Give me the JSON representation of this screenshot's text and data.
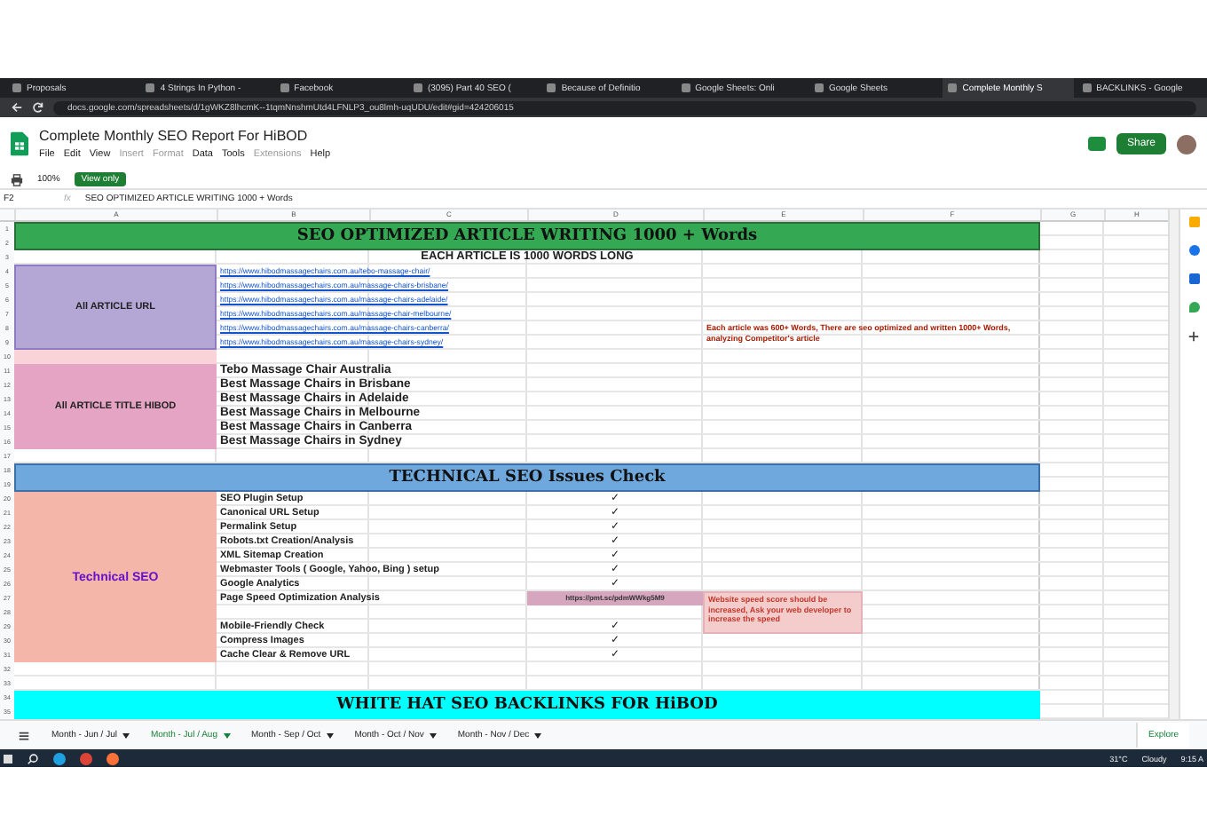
{
  "browser": {
    "tabs": [
      {
        "label": "Proposals",
        "selected": false
      },
      {
        "label": "4 Strings In Python -",
        "selected": false
      },
      {
        "label": "Facebook",
        "selected": false
      },
      {
        "label": "(3095) Part 40 SEO (",
        "selected": false
      },
      {
        "label": "Because of Definitio",
        "selected": false
      },
      {
        "label": "Google Sheets: Onli",
        "selected": false
      },
      {
        "label": "Google Sheets",
        "selected": false
      },
      {
        "label": "Complete Monthly S",
        "selected": true
      },
      {
        "label": "BACKLINKS - Google",
        "selected": false
      }
    ],
    "address": "docs.google.com/spreadsheets/d/1gWKZ8lhcmK--1tqmNnshmUtd4LFNLP3_ou8lmh-uqUDU/edit#gid=424206015"
  },
  "doc": {
    "title": "Complete Monthly SEO Report For HiBOD",
    "menu": [
      {
        "label": "File",
        "disabled": false
      },
      {
        "label": "Edit",
        "disabled": false
      },
      {
        "label": "View",
        "disabled": false
      },
      {
        "label": "Insert",
        "disabled": true
      },
      {
        "label": "Format",
        "disabled": true
      },
      {
        "label": "Data",
        "disabled": false
      },
      {
        "label": "Tools",
        "disabled": false
      },
      {
        "label": "Extensions",
        "disabled": true
      },
      {
        "label": "Help",
        "disabled": false
      }
    ],
    "zoom": "100%",
    "view_mode": "View only",
    "share": "Share"
  },
  "formula_bar": {
    "cell": "F2",
    "fx": "fx",
    "value": "SEO OPTIMIZED ARTICLE WRITING 1000 + Words"
  },
  "columns": [
    "A",
    "B",
    "C",
    "D",
    "E",
    "F",
    "G",
    "H"
  ],
  "row_numbers": [
    "1",
    "2",
    "3",
    "4",
    "5",
    "6",
    "7",
    "8",
    "9",
    "10",
    "11",
    "12",
    "13",
    "14",
    "15",
    "16",
    "17",
    "18",
    "19",
    "20",
    "21",
    "22",
    "23",
    "24",
    "25",
    "26",
    "27",
    "28",
    "29",
    "30",
    "31",
    "32",
    "33",
    "34",
    "35"
  ],
  "sheet": {
    "title": "SEO OPTIMIZED ARTICLE WRITING 1000 + Words",
    "subtitle": "EACH ARTICLE IS 1000 WORDS LONG",
    "url_label": "All ARTICLE URL",
    "urls": [
      "https://www.hibodmassagechairs.com.au/tebo-massage-chair/",
      "https://www.hibodmassagechairs.com.au/massage-chairs-brisbane/",
      "https://www.hibodmassagechairs.com.au/massage-chairs-adelaide/",
      "https://www.hibodmassagechairs.com.au/massage-chair-melbourne/",
      "https://www.hibodmassagechairs.com.au/massage-chairs-canberra/",
      "https://www.hibodmassagechairs.com.au/massage-chairs-sydney/"
    ],
    "article_note": "Each article was 600+ Words, There are seo optimized and written 1000+ Words, analyzing Competitor's article",
    "title_label": "All ARTICLE TITLE HIBOD",
    "titles": [
      "Tebo Massage Chair Australia",
      "Best Massage Chairs in Brisbane",
      "Best Massage Chairs in Adelaide",
      "Best Massage Chairs in Melbourne",
      "Best Massage Chairs in Canberra",
      "Best Massage Chairs in Sydney"
    ],
    "technical_title": "TECHNICAL SEO Issues Check",
    "technical_label": "Technical SEO",
    "technical_items": [
      {
        "kind": "check",
        "label": "SEO Plugin Setup",
        "checked": true,
        "mark": "✓"
      },
      {
        "kind": "check",
        "label": "Canonical URL Setup",
        "checked": true,
        "mark": "✓"
      },
      {
        "kind": "check",
        "label": "Permalink Setup",
        "checked": true,
        "mark": "✓"
      },
      {
        "kind": "check",
        "label": "Robots.txt Creation/Analysis",
        "checked": true,
        "mark": "✓"
      },
      {
        "kind": "check",
        "label": "XML Sitemap Creation",
        "checked": true,
        "mark": "✓"
      },
      {
        "kind": "check",
        "label": "Webmaster Tools ( Google, Yahoo, Bing ) setup",
        "checked": true,
        "mark": "✓"
      },
      {
        "kind": "check",
        "label": "Google Analytics",
        "checked": true,
        "mark": "✓"
      },
      {
        "kind": "link",
        "label": "Page Speed Optimization Analysis",
        "link": "https://pmt.sc/pdmWWkg5M9",
        "note": "Website speed score should be increased, Ask your web developer to increase the speed"
      },
      {
        "kind": "check",
        "label": "Mobile-Friendly Check",
        "checked": true,
        "mark": "✓"
      },
      {
        "kind": "check",
        "label": "Compress Images",
        "checked": true,
        "mark": "✓"
      },
      {
        "kind": "check",
        "label": "Cache Clear & Remove URL",
        "checked": true,
        "mark": "✓"
      }
    ],
    "backlinks_title": "WHITE HAT SEO BACKLINKS FOR HiBOD"
  },
  "sheet_tabs": [
    {
      "label": "Month - Jun / Jul",
      "selected": false
    },
    {
      "label": "Month - Jul / Aug",
      "selected": true
    },
    {
      "label": "Month - Sep / Oct",
      "selected": false
    },
    {
      "label": "Month - Oct / Nov",
      "selected": false
    },
    {
      "label": "Month - Nov / Dec",
      "selected": false
    }
  ],
  "explore": "Explore",
  "taskbar": {
    "temperature": "31°C",
    "weather": "Cloudy",
    "time": "9:15 A"
  }
}
